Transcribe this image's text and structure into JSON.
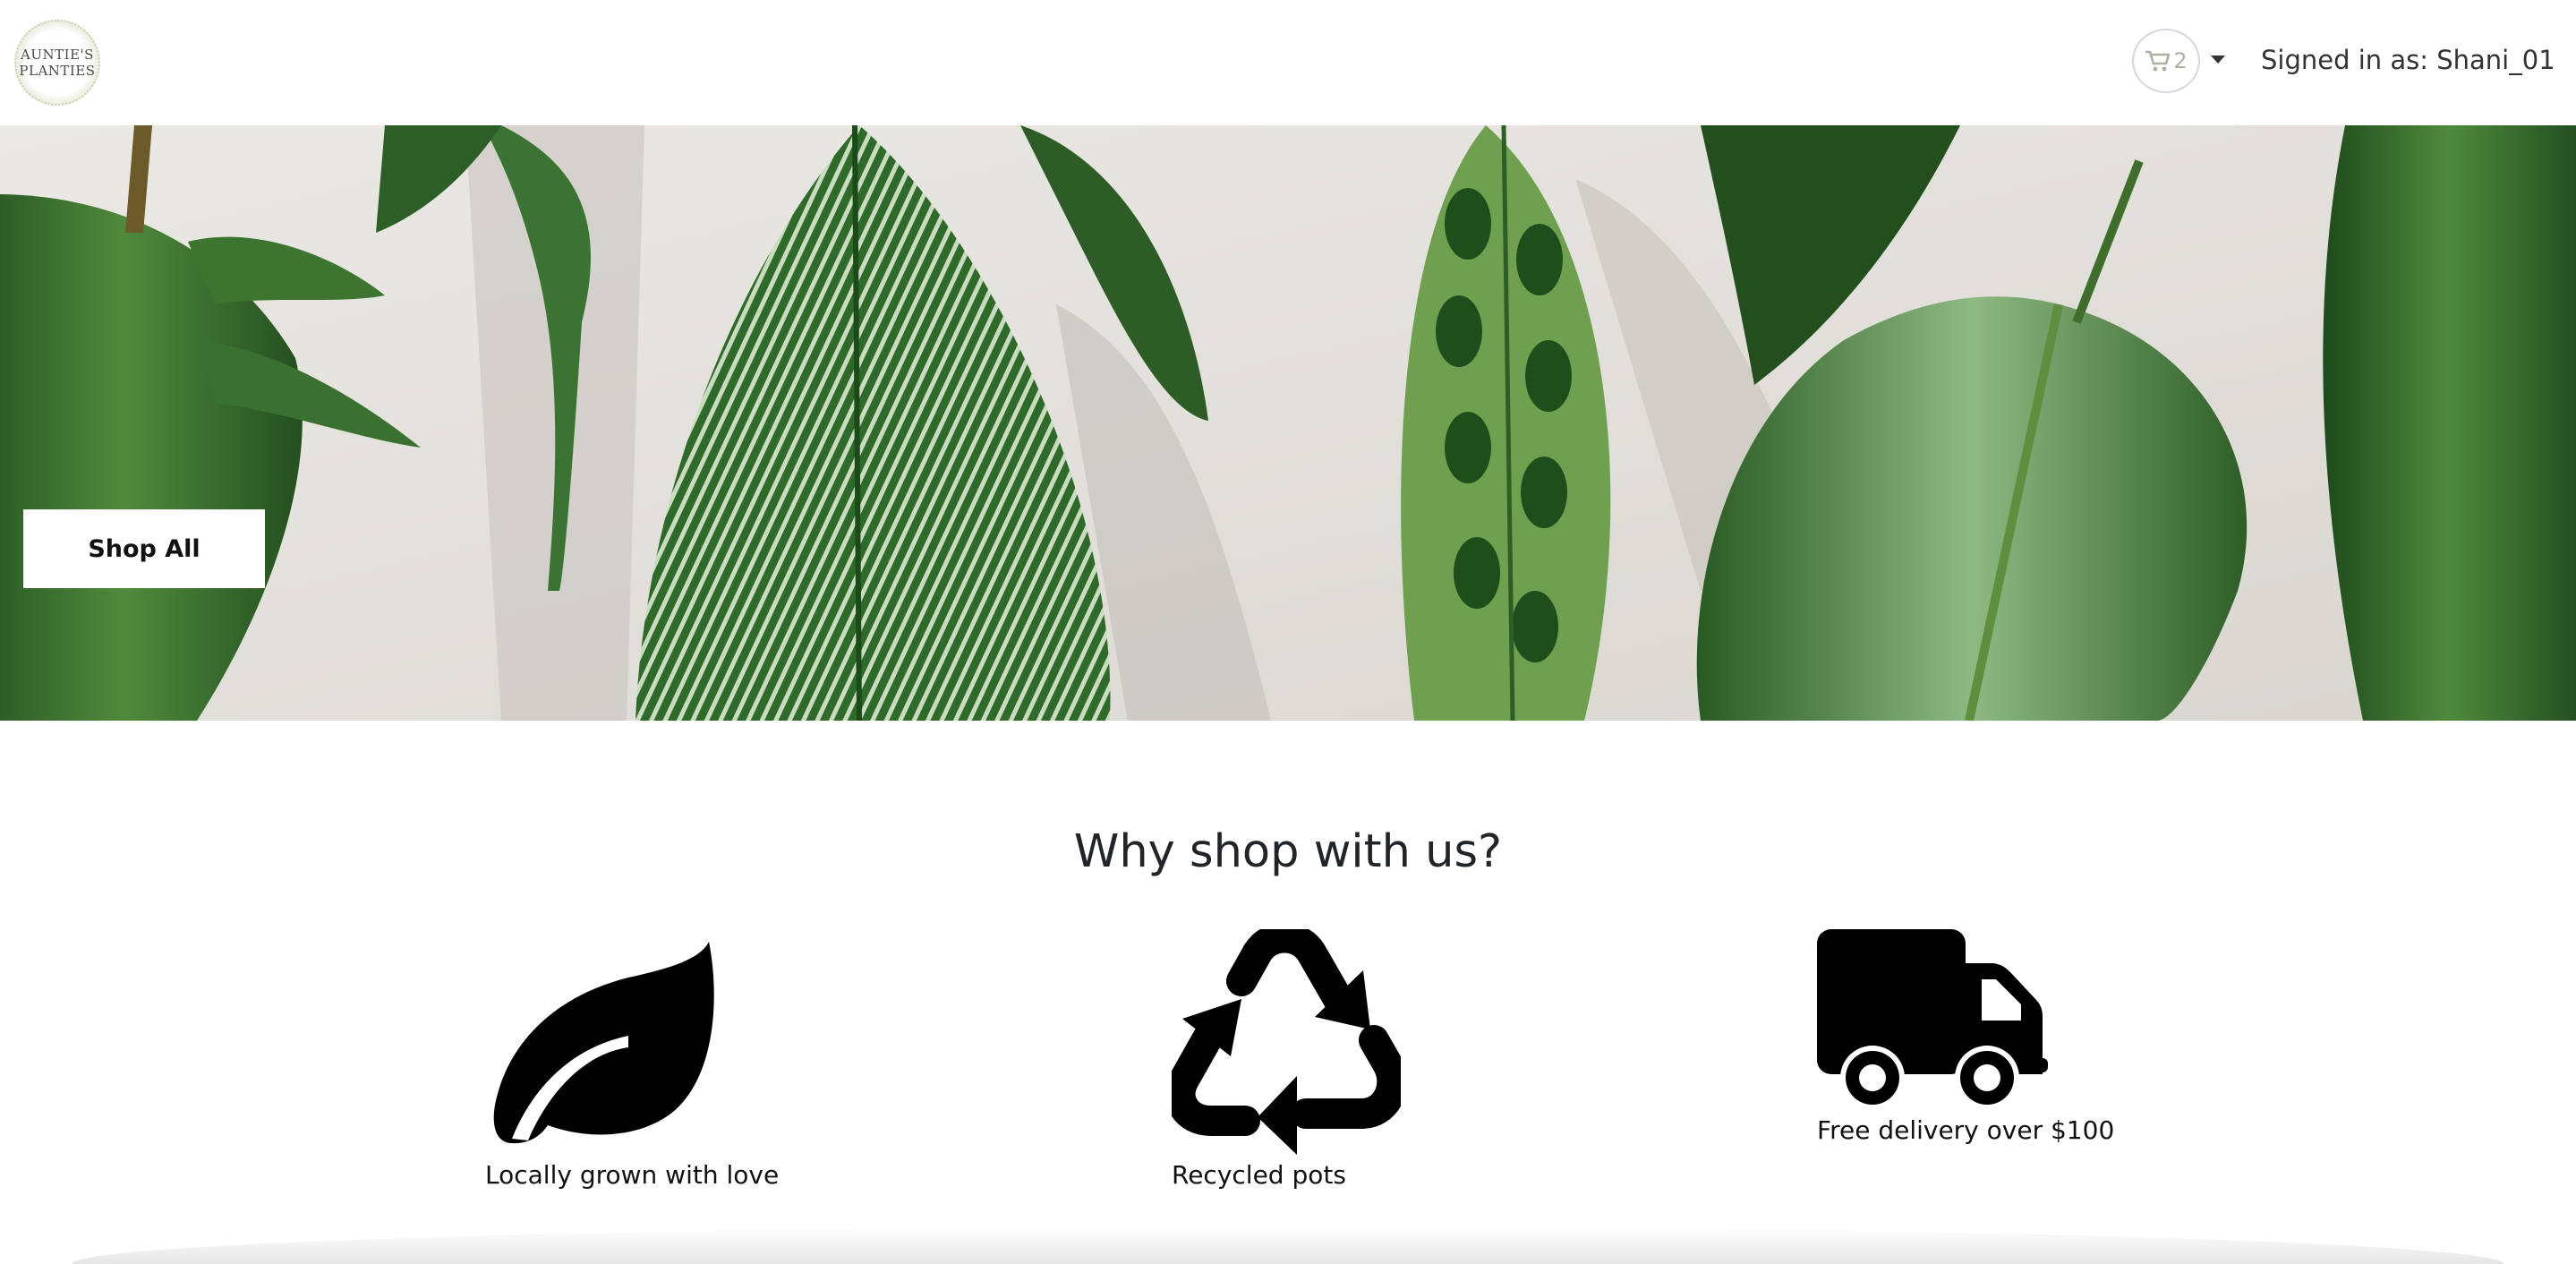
{
  "brand": {
    "logo_line1": "AUNTIE'S",
    "logo_line2": "PLANTIES"
  },
  "header": {
    "cart_count": "2",
    "signed_in_text": "Signed in as: Shani_01"
  },
  "hero": {
    "cta_label": "Shop All",
    "image_subject": "tropical leaves on a light wall"
  },
  "why": {
    "title": "Why shop with us?",
    "features": [
      {
        "icon": "leaf-icon",
        "label": "Locally grown with love"
      },
      {
        "icon": "recycle-icon",
        "label": "Recycled pots"
      },
      {
        "icon": "truck-icon",
        "label": "Free delivery over $100"
      }
    ]
  },
  "colors": {
    "accent_green": "#2f5a2a",
    "cart_icon": "#a9b3a0",
    "text": "#212529"
  }
}
